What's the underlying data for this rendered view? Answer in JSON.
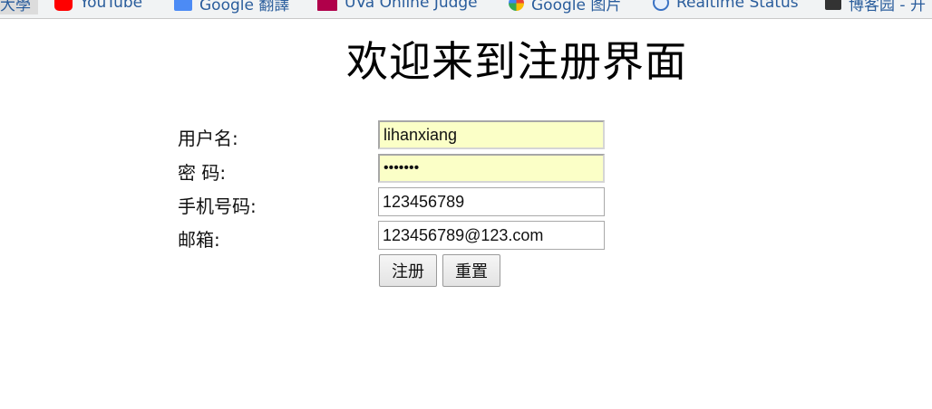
{
  "bookmarks": [
    {
      "label": "大學",
      "icon": "university-icon"
    },
    {
      "label": "YouTube",
      "icon": "youtube-icon"
    },
    {
      "label": "Google 翻譯",
      "icon": "translate-icon"
    },
    {
      "label": "UVa Online Judge",
      "icon": "uva-icon"
    },
    {
      "label": "Google 图片",
      "icon": "google-icon"
    },
    {
      "label": "Realtime Status",
      "icon": "realtime-icon"
    },
    {
      "label": "博客园 - 开",
      "icon": "blog-icon"
    }
  ],
  "page": {
    "title": "欢迎来到注册界面"
  },
  "form": {
    "username": {
      "label": "用户名:",
      "value": "lihanxiang"
    },
    "password": {
      "label": "密 码:",
      "value": "•••••••"
    },
    "phone": {
      "label": "手机号码:",
      "value": "123456789"
    },
    "email": {
      "label": "邮箱:",
      "value": "123456789@123.com"
    },
    "submit_label": "注册",
    "reset_label": "重置"
  }
}
